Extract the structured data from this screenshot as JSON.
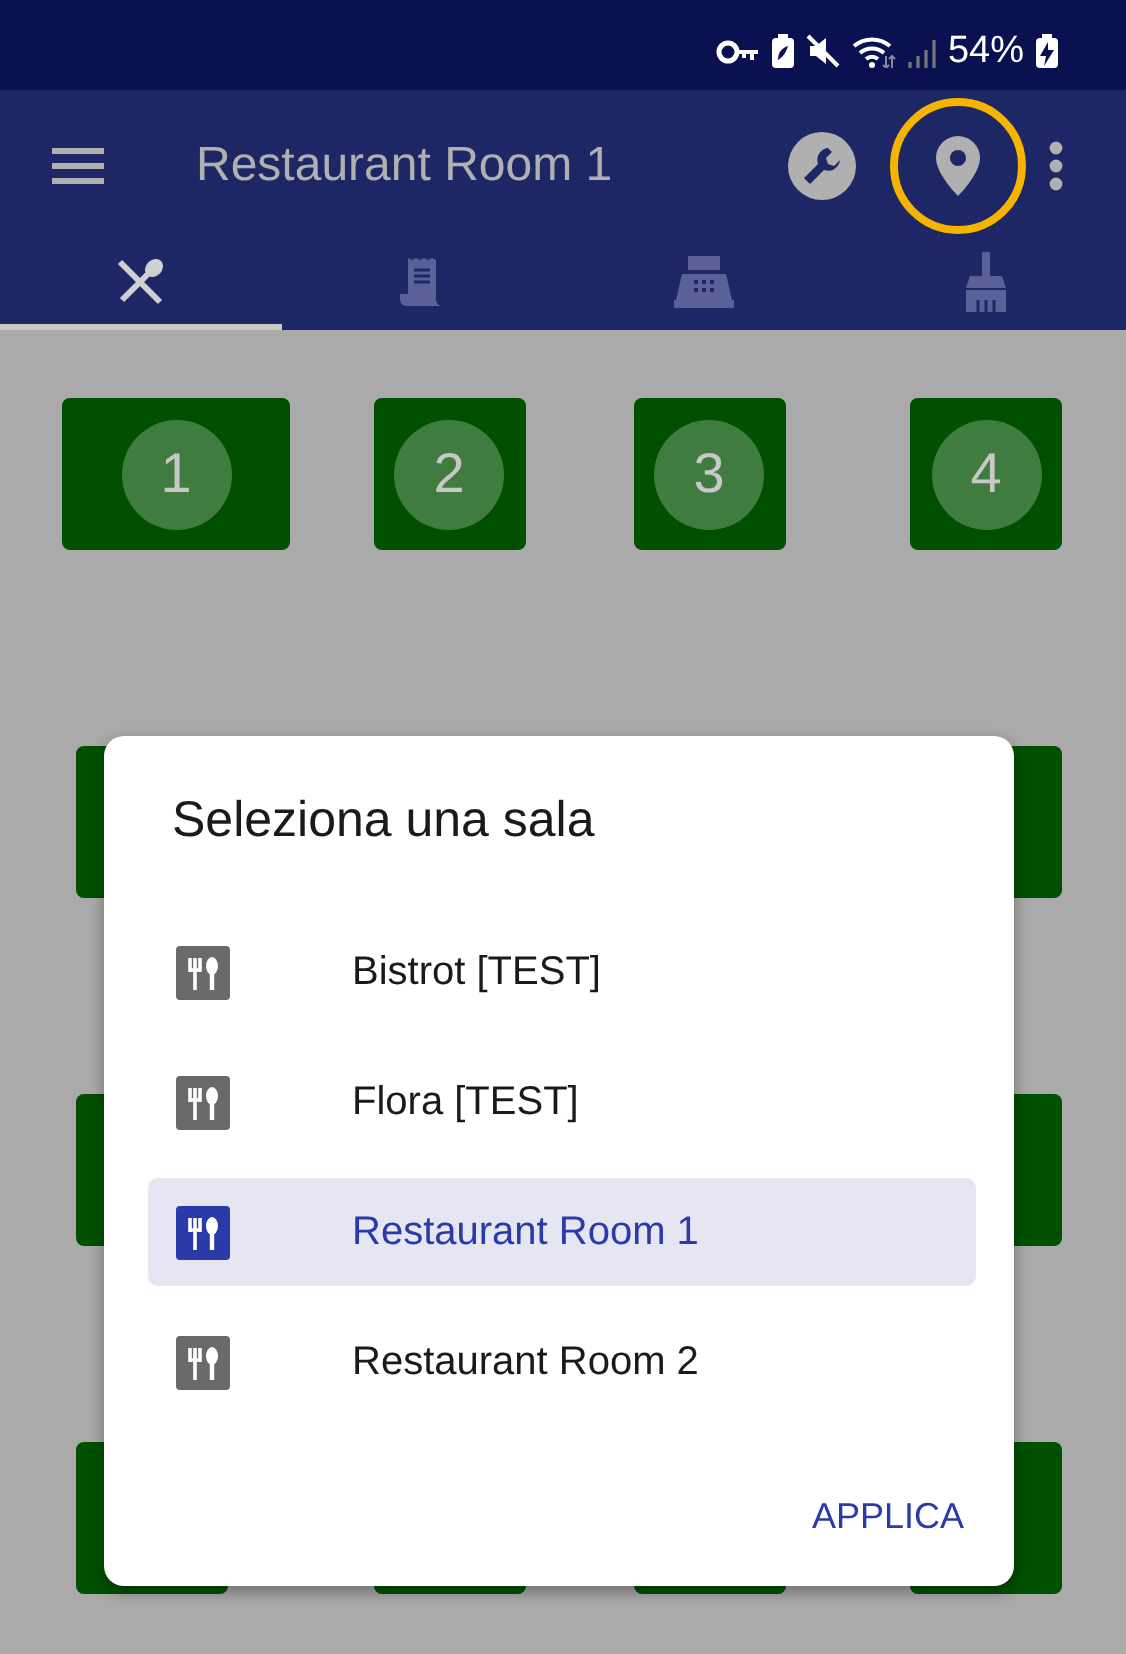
{
  "status_bar": {
    "battery_percent": "54%"
  },
  "app_bar": {
    "title": "Restaurant Room 1",
    "actions": [
      {
        "kind": "wrench",
        "highlighted": false
      },
      {
        "kind": "location",
        "highlighted": true
      },
      {
        "kind": "more",
        "highlighted": false
      }
    ]
  },
  "tabs": [
    {
      "kind": "dining",
      "selected": true
    },
    {
      "kind": "receipt",
      "selected": false
    },
    {
      "kind": "register",
      "selected": false
    },
    {
      "kind": "cleaning",
      "selected": false
    }
  ],
  "table_rows": [
    {
      "tables": [
        {
          "kind": "table",
          "number": "1",
          "wide": true
        },
        {
          "kind": "table",
          "number": "2",
          "wide": false
        },
        {
          "kind": "table",
          "number": "3",
          "wide": false
        },
        {
          "kind": "table",
          "number": "4",
          "wide": false
        }
      ]
    },
    {
      "tables": [
        {
          "kind": "table",
          "wide": false
        },
        {
          "kind": "table",
          "wide": false
        }
      ]
    },
    {
      "tables": [
        {
          "kind": "table",
          "wide": false
        },
        {
          "kind": "table",
          "wide": false
        }
      ]
    },
    {
      "tables": [
        {
          "kind": "table",
          "wide": false
        },
        {
          "kind": "table",
          "wide": false
        },
        {
          "kind": "table",
          "wide": false
        },
        {
          "kind": "table",
          "wide": false
        }
      ]
    }
  ],
  "dialog": {
    "title": "Seleziona una sala",
    "rooms": [
      {
        "label": "Bistrot [TEST]",
        "selected": false
      },
      {
        "label": "Flora [TEST]",
        "selected": false
      },
      {
        "label": "Restaurant Room 1",
        "selected": true
      },
      {
        "label": "Restaurant Room 2",
        "selected": false
      }
    ],
    "button": "APPLICA"
  }
}
